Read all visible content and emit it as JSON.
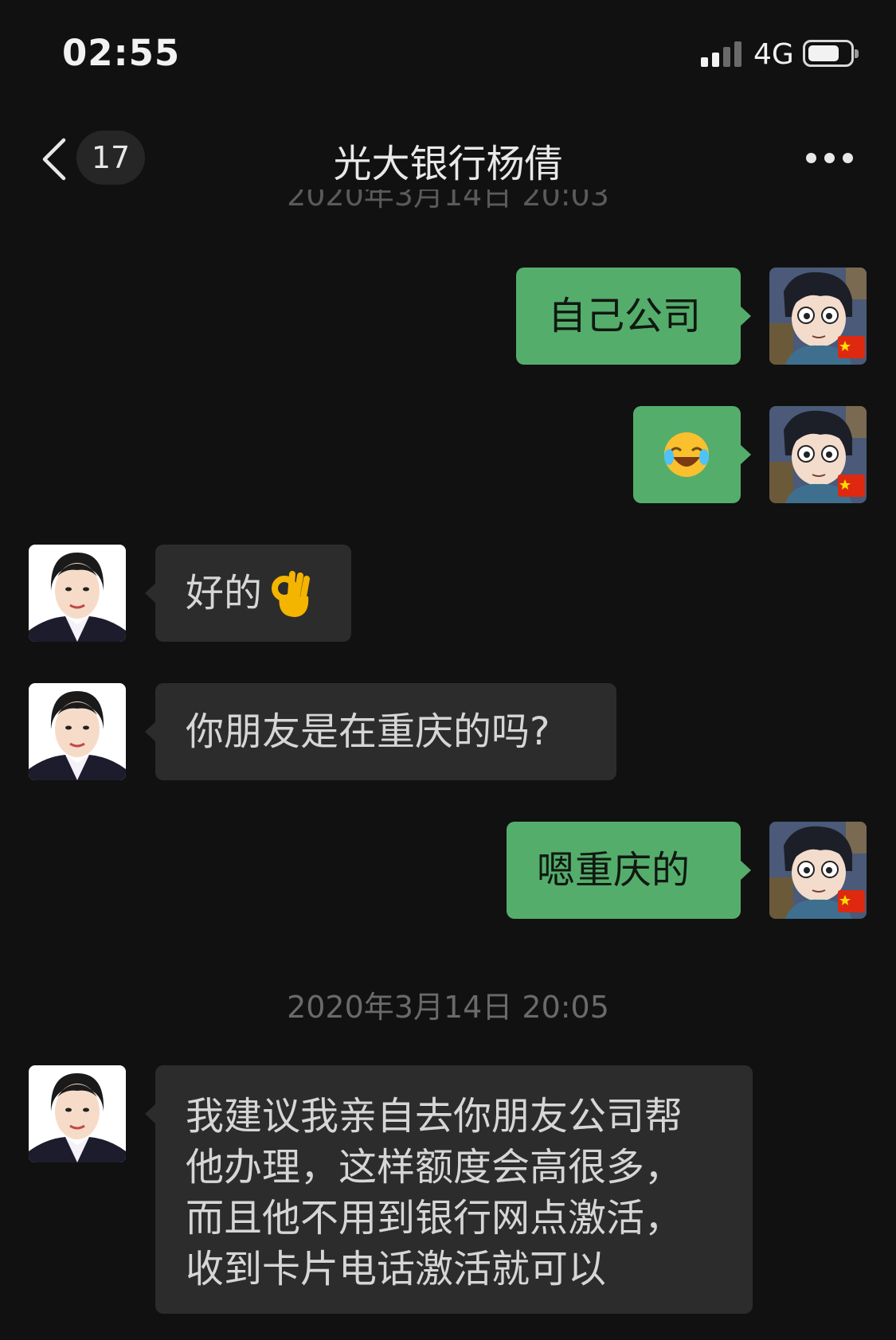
{
  "status_bar": {
    "time": "02:55",
    "network": "4G",
    "battery_level": 0.75
  },
  "nav": {
    "unread_count": "17",
    "title": "光大银行杨倩"
  },
  "timestamps": {
    "top_partial": "2020年3月14日 20:03",
    "second": "2020年3月14日 20:05"
  },
  "messages": [
    {
      "side": "out",
      "text": "自己公司"
    },
    {
      "side": "out",
      "emoji": "face-with-tears-of-joy"
    },
    {
      "side": "in",
      "text": "好的",
      "emoji": "ok-hand"
    },
    {
      "side": "in",
      "text": "你朋友是在重庆的吗?"
    },
    {
      "side": "out",
      "text": "嗯重庆的"
    },
    {
      "side": "in",
      "lines": [
        "我建议我亲自去你朋友公司帮",
        "他办理，这样额度会高很多，",
        "而且他不用到银行网点激活，",
        "收到卡片电话激活就可以"
      ]
    }
  ],
  "colors": {
    "background": "#111111",
    "outgoing_bubble": "#55ad6c",
    "incoming_bubble": "#2c2c2c"
  },
  "icons": {
    "back": "chevron-left-icon",
    "more": "more-dots-icon",
    "signal": "signal-bars-icon",
    "battery": "battery-icon"
  }
}
